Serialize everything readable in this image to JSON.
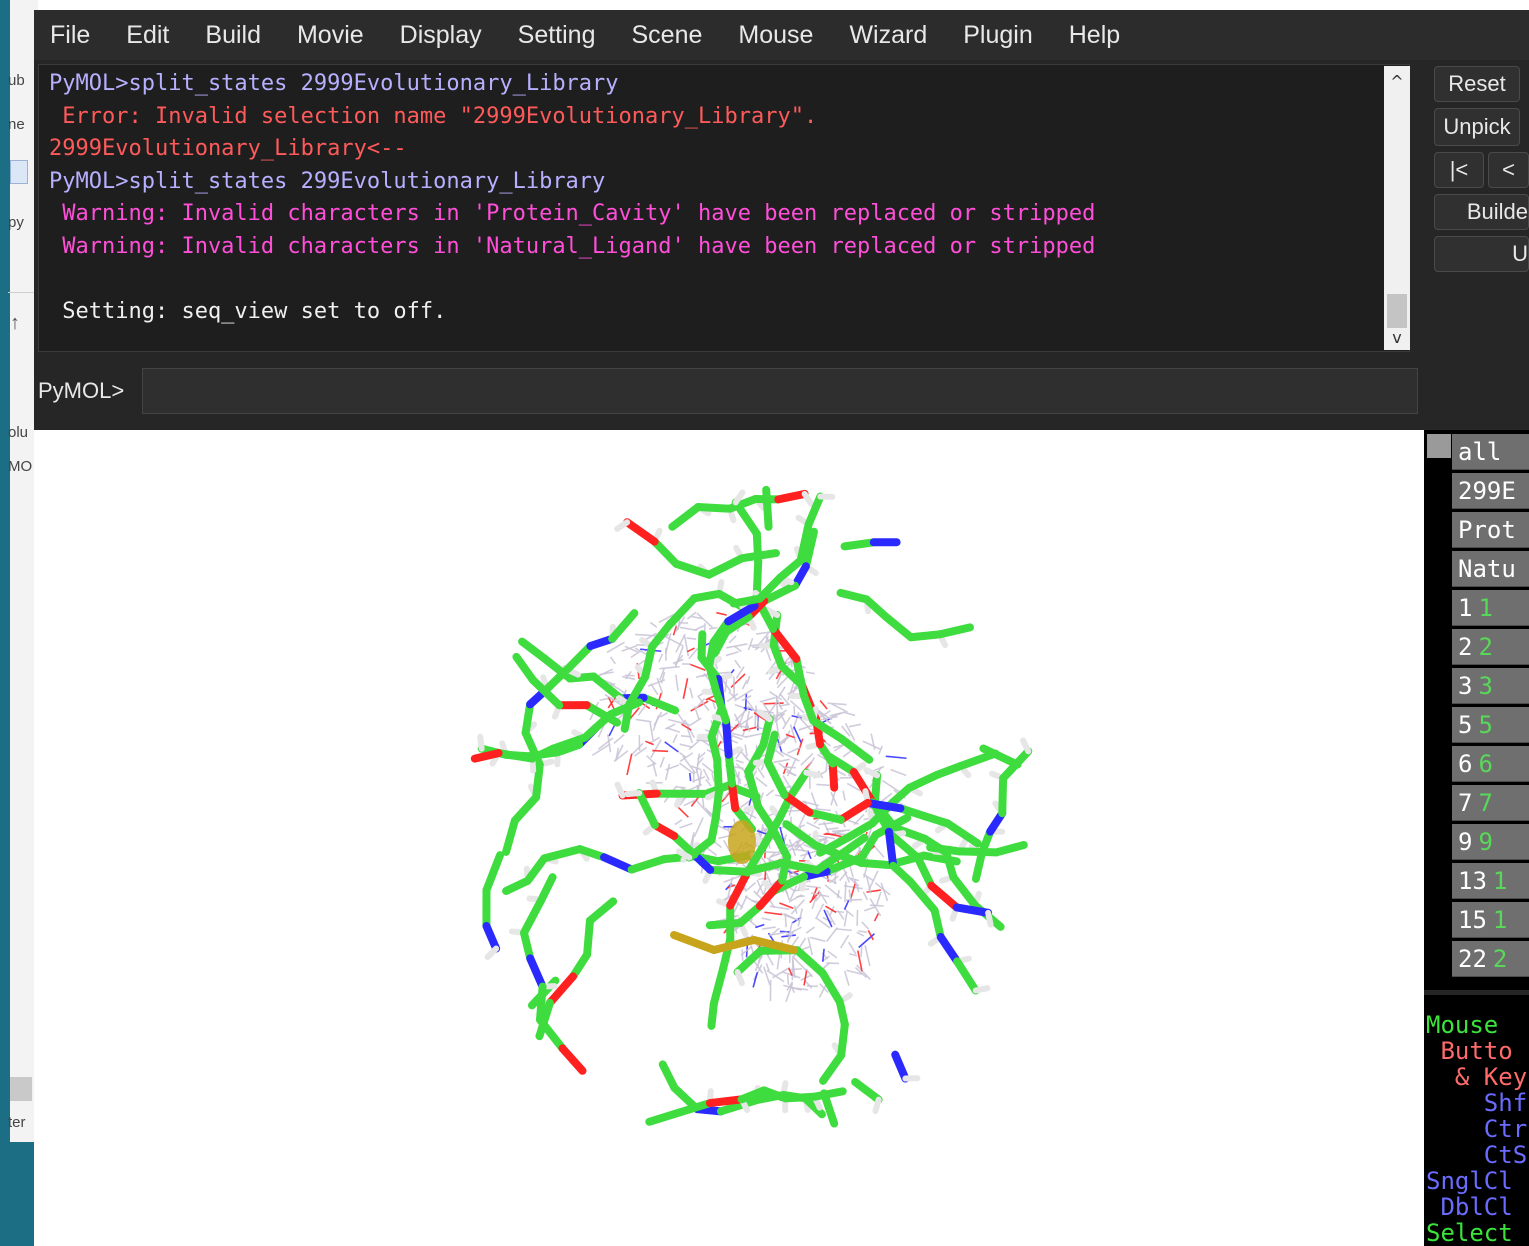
{
  "menubar": {
    "items": [
      "File",
      "Edit",
      "Build",
      "Movie",
      "Display",
      "Setting",
      "Scene",
      "Mouse",
      "Wizard",
      "Plugin",
      "Help"
    ]
  },
  "console": {
    "lines": [
      {
        "text": "PyMOL>split_states 2999Evolutionary_Library",
        "kind": "prompt"
      },
      {
        "text": " Error: Invalid selection name \"2999Evolutionary_Library\".",
        "kind": "error"
      },
      {
        "text": "2999Evolutionary_Library<--",
        "kind": "error"
      },
      {
        "text": "PyMOL>split_states 299Evolutionary_Library",
        "kind": "prompt"
      },
      {
        "text": " Warning: Invalid characters in 'Protein_Cavity' have been replaced or stripped",
        "kind": "warning"
      },
      {
        "text": " Warning: Invalid characters in 'Natural_Ligand' have been replaced or stripped",
        "kind": "warning"
      },
      {
        "text": "",
        "kind": "plain"
      },
      {
        "text": " Setting: seq_view set to off.",
        "kind": "plain"
      }
    ],
    "scroll_up": "^",
    "scroll_down": "v"
  },
  "command": {
    "label": "PyMOL>",
    "value": ""
  },
  "buttons": {
    "reset": "Reset",
    "unpick": "Unpick",
    "rewind": "|<",
    "back": "<",
    "builder": "Builde",
    "u": "U"
  },
  "objects": [
    {
      "name": "all",
      "state": ""
    },
    {
      "name": "299E",
      "state": ""
    },
    {
      "name": "Prot",
      "state": ""
    },
    {
      "name": "Natu",
      "state": ""
    },
    {
      "name": "1",
      "state": "1"
    },
    {
      "name": "2",
      "state": "2"
    },
    {
      "name": "3",
      "state": "3"
    },
    {
      "name": "5",
      "state": "5"
    },
    {
      "name": "6",
      "state": "6"
    },
    {
      "name": "7",
      "state": "7"
    },
    {
      "name": "9",
      "state": "9"
    },
    {
      "name": "13",
      "state": "1"
    },
    {
      "name": "15",
      "state": "1"
    },
    {
      "name": "22",
      "state": "2"
    }
  ],
  "mouse_panel": {
    "lines": [
      {
        "text": "Mouse",
        "color": "#3be33b"
      },
      {
        "text": " Butto",
        "color": "#ff6a6a"
      },
      {
        "text": "  & Key",
        "color": "#ff6a6a"
      },
      {
        "text": "    Shf",
        "color": "#6b6bff"
      },
      {
        "text": "    Ctr",
        "color": "#6b6bff"
      },
      {
        "text": "    CtS",
        "color": "#6b6bff"
      },
      {
        "text": "SnglCl",
        "color": "#6b6bff"
      },
      {
        "text": " DblCl",
        "color": "#6b6bff"
      },
      {
        "text": "Select",
        "color": "#3be33b"
      }
    ]
  },
  "left_strip": {
    "fragments": [
      "ub",
      "ne",
      "py",
      "olu",
      "MO",
      "ter"
    ]
  },
  "colors": {
    "carbon": "#3fdc3f",
    "nitrogen": "#2a2aff",
    "oxygen": "#ff2020",
    "hydrogen": "#e6e6e6",
    "sulfur": "#c8a41c",
    "ligand_cloud": "#c9c4d6"
  }
}
